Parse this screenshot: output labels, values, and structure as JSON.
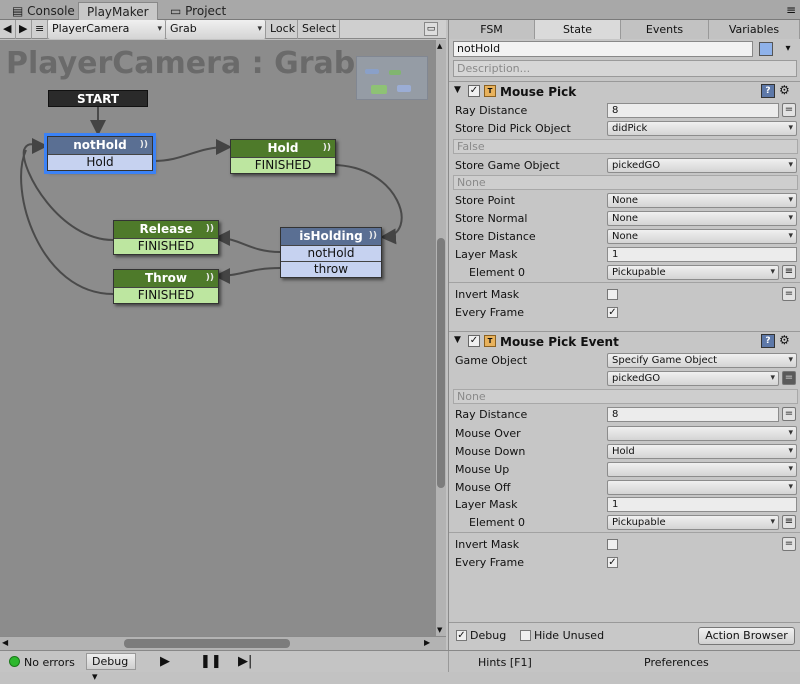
{
  "window_tabs": [
    {
      "label": "Console",
      "icon": "console-icon"
    },
    {
      "label": "PlayMaker",
      "icon": ""
    },
    {
      "label": "Project",
      "icon": "folder-icon"
    }
  ],
  "toolbar": {
    "object": "PlayerCamera",
    "fsm": "Grab",
    "lock": "Lock",
    "select": "Select"
  },
  "graph": {
    "title": "PlayerCamera : Grab",
    "start": "START",
    "states": [
      {
        "name": "notHold",
        "events": [
          "Hold"
        ],
        "color": "blue",
        "selected": true
      },
      {
        "name": "Hold",
        "events": [
          "FINISHED"
        ],
        "color": "green"
      },
      {
        "name": "Release",
        "events": [
          "FINISHED"
        ],
        "color": "green"
      },
      {
        "name": "Throw",
        "events": [
          "FINISHED"
        ],
        "color": "green"
      },
      {
        "name": "isHolding",
        "events": [
          "notHold",
          "throw"
        ],
        "color": "blue"
      }
    ]
  },
  "inspector": {
    "tabs": [
      "FSM",
      "State",
      "Events",
      "Variables"
    ],
    "active_tab": "State",
    "state_name": "notHold",
    "description_placeholder": "Description...",
    "actions": [
      {
        "title": "Mouse Pick",
        "rows": [
          {
            "label": "Ray Distance",
            "value": "8",
            "kind": "text"
          },
          {
            "label": "Store Did Pick Object",
            "value": "didPick",
            "kind": "dropdown"
          },
          {
            "hint": "False"
          },
          {
            "label": "Store Game Object",
            "value": "pickedGO",
            "kind": "dropdown"
          },
          {
            "hint": "None"
          },
          {
            "label": "Store Point",
            "value": "None",
            "kind": "dropdown"
          },
          {
            "label": "Store Normal",
            "value": "None",
            "kind": "dropdown"
          },
          {
            "label": "Store Distance",
            "value": "None",
            "kind": "dropdown"
          },
          {
            "label": "Layer Mask",
            "value": "1",
            "kind": "text"
          },
          {
            "label": "Element 0",
            "value": "Pickupable",
            "kind": "dropdown"
          },
          {
            "label": "Invert Mask",
            "checked": false,
            "kind": "check"
          },
          {
            "label": "Every Frame",
            "checked": true,
            "kind": "check"
          }
        ]
      },
      {
        "title": "Mouse Pick Event",
        "rows": [
          {
            "label": "Game Object",
            "value": "Specify Game Object",
            "kind": "dropdown"
          },
          {
            "label": "",
            "value": "pickedGO",
            "kind": "dropdown"
          },
          {
            "hint": "None"
          },
          {
            "label": "Ray Distance",
            "value": "8",
            "kind": "text"
          },
          {
            "label": "Mouse Over",
            "value": "",
            "kind": "dropdown"
          },
          {
            "label": "Mouse Down",
            "value": "Hold",
            "kind": "dropdown"
          },
          {
            "label": "Mouse Up",
            "value": "",
            "kind": "dropdown"
          },
          {
            "label": "Mouse Off",
            "value": "",
            "kind": "dropdown"
          },
          {
            "label": "Layer Mask",
            "value": "1",
            "kind": "text"
          },
          {
            "label": "Element 0",
            "value": "Pickupable",
            "kind": "dropdown"
          },
          {
            "label": "Invert Mask",
            "checked": false,
            "kind": "check"
          },
          {
            "label": "Every Frame",
            "checked": true,
            "kind": "check"
          }
        ]
      }
    ],
    "footer": {
      "debug": "Debug",
      "debug_checked": true,
      "hide_unused": "Hide Unused",
      "hide_unused_checked": false,
      "action_browser": "Action Browser"
    }
  },
  "status": {
    "errors": "No errors",
    "mode": "Debug",
    "hints": "Hints [F1]",
    "preferences": "Preferences"
  },
  "colors": {
    "state_blue": "#5a6f93",
    "state_green": "#4e7a2a",
    "selection": "#3b82f6",
    "graph_bg": "#8c8c8c"
  }
}
